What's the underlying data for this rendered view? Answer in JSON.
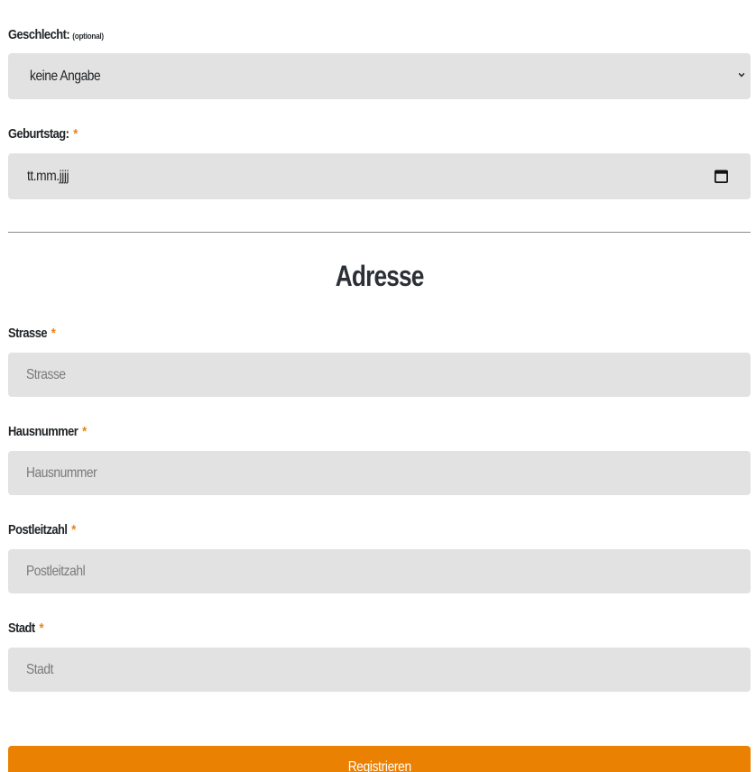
{
  "gender": {
    "label": "Geschlecht:",
    "optional": "(optional)",
    "selected": "keine Angabe"
  },
  "birthday": {
    "label": "Geburtstag:",
    "required_mark": "*",
    "value": "tt.mm.jjjj"
  },
  "address": {
    "title": "Adresse",
    "street": {
      "label": "Strasse",
      "required_mark": "*",
      "placeholder": "Strasse"
    },
    "house_number": {
      "label": "Hausnummer",
      "required_mark": "*",
      "placeholder": "Hausnummer"
    },
    "postal_code": {
      "label": "Postleitzahl",
      "required_mark": "*",
      "placeholder": "Postleitzahl"
    },
    "city": {
      "label": "Stadt",
      "required_mark": "*",
      "placeholder": "Stadt"
    }
  },
  "submit": {
    "label": "Registrieren"
  },
  "colors": {
    "accent": "#eb8103",
    "required": "#e98311",
    "field_bg": "#e2e2e2"
  },
  "icons": {
    "select_arrow": "chevron-down-icon",
    "date_picker": "calendar-icon"
  }
}
